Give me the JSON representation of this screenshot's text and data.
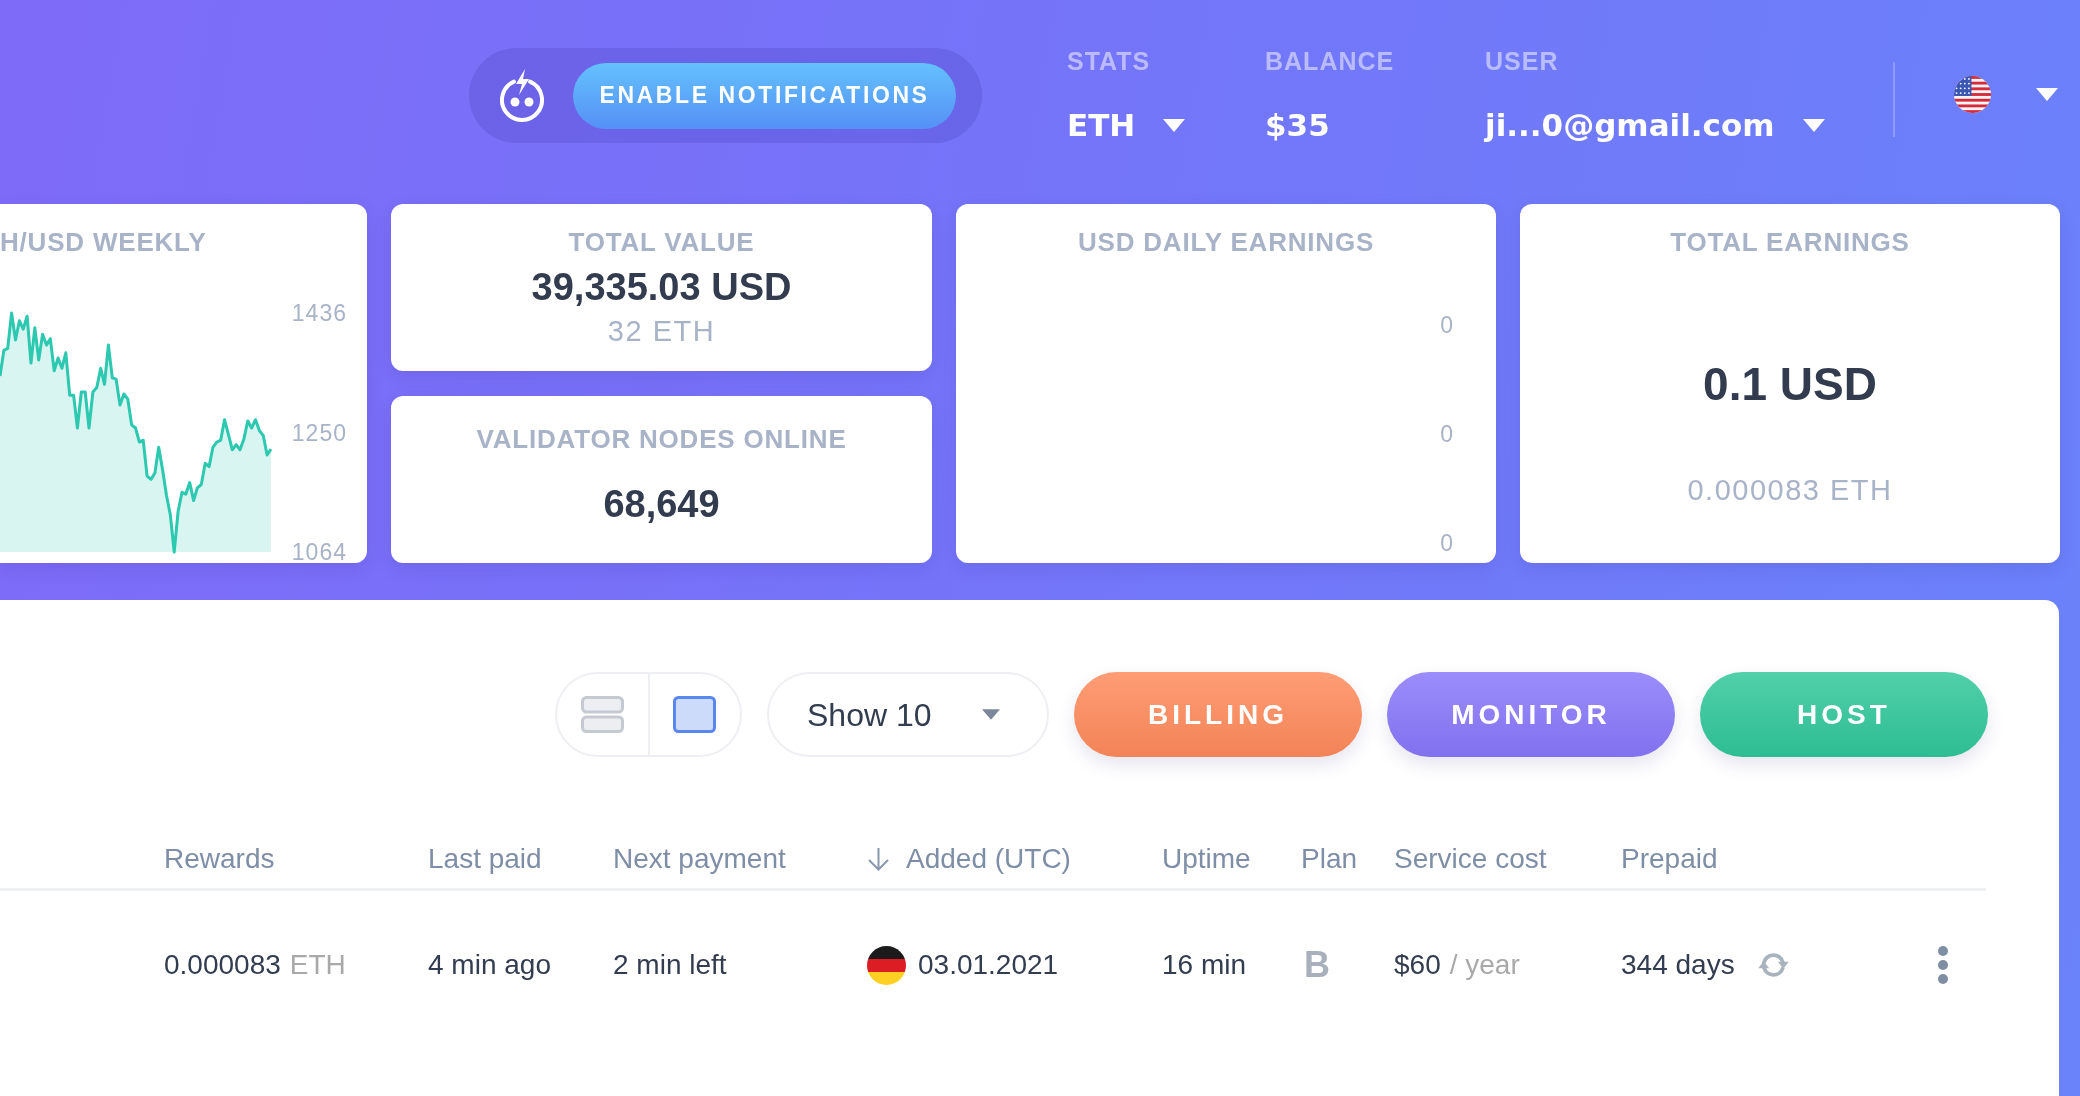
{
  "header": {
    "notification_button": {
      "label": "ENABLE NOTIFICATIONS"
    },
    "stats": [
      {
        "label": "STATS",
        "value": "ETH",
        "dropdown": true
      },
      {
        "label": "BALANCE",
        "value": "$35",
        "dropdown": false
      },
      {
        "label": "USER",
        "value": "ji...0@gmail.com",
        "dropdown": true
      }
    ]
  },
  "price_chart": {
    "chart_data": {
      "type": "area",
      "title": "H/USD WEEKLY",
      "categories": [
        null,
        null,
        null,
        null,
        null,
        null,
        null,
        null,
        null,
        null,
        null,
        null,
        null,
        null,
        null,
        null,
        null,
        null,
        null,
        null,
        null,
        null,
        null,
        null,
        null,
        null,
        null,
        null,
        null,
        null,
        null,
        null,
        null,
        null,
        null,
        null,
        null,
        null,
        null,
        null,
        null,
        null,
        null,
        null,
        null,
        null,
        null,
        null,
        null,
        null,
        null,
        null,
        null,
        null,
        null,
        null,
        null,
        null,
        null,
        null,
        null,
        null,
        null,
        null,
        null,
        null,
        null,
        null,
        null,
        null,
        null
      ],
      "ylim": [
        1064,
        1436
      ],
      "yticks": [
        1064,
        1250,
        1436
      ],
      "series": [
        {
          "color": "#2cc8b0",
          "values": [
            1338,
            1378,
            1381,
            1436,
            1394,
            1424,
            1411,
            1431,
            1358,
            1413,
            1363,
            1403,
            1386,
            1396,
            1346,
            1366,
            1350,
            1374,
            1308,
            1308,
            1257,
            1313,
            1313,
            1257,
            1313,
            1320,
            1350,
            1325,
            1386,
            1335,
            1333,
            1293,
            1310,
            1302,
            1262,
            1257,
            1235,
            1238,
            1182,
            1177,
            1187,
            1227,
            1192,
            1152,
            1122,
            1064,
            1127,
            1157,
            1154,
            1172,
            1144,
            1164,
            1169,
            1202,
            1197,
            1227,
            1235,
            1238,
            1270,
            1247,
            1223,
            1231,
            1223,
            1240,
            1268,
            1257,
            1270,
            1253,
            1245,
            1215,
            1224
          ]
        }
      ]
    }
  },
  "total_value": {
    "title": "TOTAL VALUE",
    "value": "39,335.03 USD",
    "subvalue": "32 ETH"
  },
  "validator_nodes": {
    "title": "VALIDATOR NODES ONLINE",
    "value": "68,649"
  },
  "daily_earnings": {
    "title": "USD DAILY EARNINGS",
    "axis_labels": [
      "0",
      "0",
      "0"
    ]
  },
  "total_earnings": {
    "title": "TOTAL EARNINGS",
    "value": "0.1 USD",
    "subvalue": "0.000083 ETH"
  },
  "toolbar": {
    "view_modes": [
      {
        "kind": "rows",
        "selected": false
      },
      {
        "kind": "tile",
        "selected": true
      }
    ],
    "page_size": "Show 10",
    "buttons": [
      {
        "label": "BILLING",
        "color": "#ff8a5b"
      },
      {
        "label": "MONITOR",
        "color": "#8877fb"
      },
      {
        "label": "HOST",
        "color": "#30c79a"
      }
    ]
  },
  "table": {
    "columns": [
      {
        "label": "Rewards",
        "sorted": false
      },
      {
        "label": "Last paid",
        "sorted": false
      },
      {
        "label": "Next payment",
        "sorted": false
      },
      {
        "label": "Added (UTC)",
        "sorted": true
      },
      {
        "label": "Uptime",
        "sorted": false
      },
      {
        "label": "Plan",
        "sorted": false
      },
      {
        "label": "Service cost",
        "sorted": false
      },
      {
        "label": "Prepaid",
        "sorted": false
      }
    ],
    "rows": [
      {
        "cells": [
          {
            "kind": "amount",
            "value": "0.000083",
            "unit": "ETH"
          },
          {
            "kind": "text",
            "value": "4 min ago"
          },
          {
            "kind": "text",
            "value": "2 min left"
          },
          {
            "kind": "date",
            "value": "03.01.2021"
          },
          {
            "kind": "text",
            "value": "16 min"
          },
          {
            "kind": "plan",
            "value": "B"
          },
          {
            "kind": "amount",
            "value": "$60",
            "unit": "/ year"
          },
          {
            "kind": "renewal",
            "value": "344 days"
          }
        ]
      }
    ]
  }
}
